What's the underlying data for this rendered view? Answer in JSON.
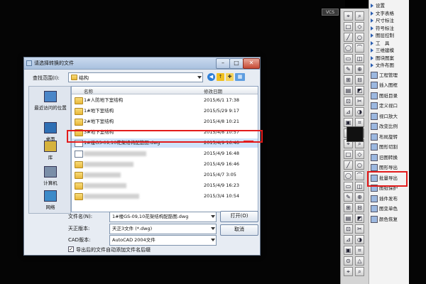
{
  "cad": {
    "vcs_label": "VCS"
  },
  "dialog": {
    "title": "请选择转换的文件",
    "lookin_label": "查找范围(I):",
    "lookin_value": "结构",
    "columns": {
      "name": "名称",
      "date": "修改日期"
    },
    "files": [
      {
        "name": "1#人防地下室结构",
        "date": "2015/6/1 17:38",
        "type": "folder"
      },
      {
        "name": "1#地下室结构",
        "date": "2015/5/29 9:17",
        "type": "folder"
      },
      {
        "name": "2#地下室结构",
        "date": "2015/4/8 10:21",
        "type": "folder"
      },
      {
        "name": "3#地下室结构",
        "date": "2015/4/8 10:57",
        "type": "folder"
      },
      {
        "name": "1#楼GS-09,10花架结构配筋图.dwg",
        "date": "2015/4/9 16:48",
        "type": "dwg",
        "selected": true
      },
      {
        "name": "",
        "date": "2015/4/9 16:48",
        "type": "dwg"
      },
      {
        "name": "",
        "date": "2015/4/9 16:46",
        "type": "folder"
      },
      {
        "name": "",
        "date": "2015/4/7 3:05",
        "type": "folder"
      },
      {
        "name": "",
        "date": "2015/4/9 16:23",
        "type": "folder"
      },
      {
        "name": "",
        "date": "2015/3/4 10:54",
        "type": "folder"
      }
    ],
    "places": [
      {
        "label": "最近访问的位置"
      },
      {
        "label": "桌面"
      },
      {
        "label": "库"
      },
      {
        "label": "计算机"
      },
      {
        "label": "网络"
      }
    ],
    "filename_label": "文件名(N):",
    "filename_value": "1#楼GS-09,10花架结构配筋图.dwg",
    "version_label": "天正版本:",
    "version_value": "天正3文件 (*.dwg)",
    "cad_label": "CAD版本:",
    "cad_value": "AutoCAD 2004文件",
    "checkbox_label": "导出后的文件自动添加文件名后缀",
    "checkbox_checked": true,
    "open_button": "打开(O)",
    "cancel_button": "取消",
    "min_glyph": "–",
    "max_glyph": "□",
    "close_glyph": "✕"
  },
  "menu": {
    "items": [
      {
        "label": "设置",
        "type": "arrow"
      },
      {
        "label": "文字表格",
        "type": "arrow"
      },
      {
        "label": "尺寸标注",
        "type": "arrow"
      },
      {
        "label": "符号标注",
        "type": "arrow"
      },
      {
        "label": "图层控制",
        "type": "arrow"
      },
      {
        "label": "工　具",
        "type": "arrow"
      },
      {
        "label": "三维建模",
        "type": "arrow"
      },
      {
        "label": "图块图案",
        "type": "arrow"
      },
      {
        "label": "文件布图",
        "type": "arrow"
      },
      {
        "label": "工程管理",
        "type": "icon"
      },
      {
        "label": "插入图框",
        "type": "icon"
      },
      {
        "label": "图纸目录",
        "type": "icon"
      },
      {
        "label": "定义视口",
        "type": "icon"
      },
      {
        "label": "视口放大",
        "type": "icon"
      },
      {
        "label": "改变比例",
        "type": "icon"
      },
      {
        "label": "布局旋转",
        "type": "icon"
      },
      {
        "label": "图形切割",
        "type": "icon"
      },
      {
        "label": "旧图转换",
        "type": "icon"
      },
      {
        "label": "图形导出",
        "type": "icon"
      },
      {
        "label": "批量导出",
        "type": "icon",
        "highlight": true
      },
      {
        "label": "图纸保护",
        "type": "icon"
      },
      {
        "label": "插件发布",
        "type": "icon"
      },
      {
        "label": "图变单色",
        "type": "icon"
      },
      {
        "label": "颜色恢复",
        "type": "icon"
      }
    ]
  }
}
